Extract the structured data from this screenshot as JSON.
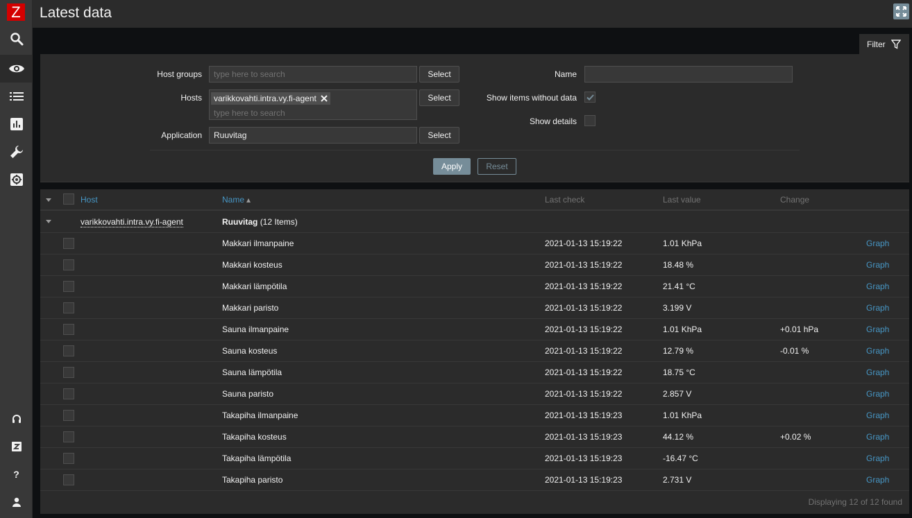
{
  "app": {
    "logo_letter": "Z"
  },
  "header": {
    "title": "Latest data"
  },
  "sidebar": {
    "items": [
      {
        "name": "search",
        "icon": "search-icon"
      },
      {
        "name": "monitoring",
        "icon": "eye-icon",
        "active": true
      },
      {
        "name": "inventory",
        "icon": "list-icon"
      },
      {
        "name": "reports",
        "icon": "bar-chart-icon"
      },
      {
        "name": "configuration",
        "icon": "wrench-icon"
      },
      {
        "name": "administration",
        "icon": "gear-icon"
      }
    ],
    "bottom": [
      {
        "name": "support",
        "icon": "headset-icon"
      },
      {
        "name": "share",
        "icon": "zabbix-share-icon"
      },
      {
        "name": "help",
        "icon": "help-icon",
        "text": "?"
      },
      {
        "name": "user-settings",
        "icon": "user-icon"
      }
    ]
  },
  "filter": {
    "tab_label": "Filter",
    "host_groups_label": "Host groups",
    "host_groups_placeholder": "type here to search",
    "hosts_label": "Hosts",
    "hosts_selected": "varikkovahti.intra.vy.fi-agent",
    "hosts_placeholder": "type here to search",
    "application_label": "Application",
    "application_value": "Ruuvitag",
    "select_label": "Select",
    "name_label": "Name",
    "name_value": "",
    "show_items_without_data_label": "Show items without data",
    "show_items_without_data": true,
    "show_details_label": "Show details",
    "show_details": false,
    "apply_label": "Apply",
    "reset_label": "Reset"
  },
  "table": {
    "columns": {
      "host": "Host",
      "name": "Name",
      "last_check": "Last check",
      "last_value": "Last value",
      "change": "Change"
    },
    "group": {
      "host": "varikkovahti.intra.vy.fi-agent",
      "app": "Ruuvitag",
      "count": "(12 Items)"
    },
    "graph_label": "Graph",
    "rows": [
      {
        "name": "Makkari ilmanpaine",
        "last_check": "2021-01-13 15:19:22",
        "last_value": "1.01 KhPa",
        "change": ""
      },
      {
        "name": "Makkari kosteus",
        "last_check": "2021-01-13 15:19:22",
        "last_value": "18.48 %",
        "change": ""
      },
      {
        "name": "Makkari lämpötila",
        "last_check": "2021-01-13 15:19:22",
        "last_value": "21.41 °C",
        "change": ""
      },
      {
        "name": "Makkari paristo",
        "last_check": "2021-01-13 15:19:22",
        "last_value": "3.199 V",
        "change": ""
      },
      {
        "name": "Sauna ilmanpaine",
        "last_check": "2021-01-13 15:19:22",
        "last_value": "1.01 KhPa",
        "change": "+0.01 hPa"
      },
      {
        "name": "Sauna kosteus",
        "last_check": "2021-01-13 15:19:22",
        "last_value": "12.79 %",
        "change": "-0.01 %"
      },
      {
        "name": "Sauna lämpötila",
        "last_check": "2021-01-13 15:19:22",
        "last_value": "18.75 °C",
        "change": ""
      },
      {
        "name": "Sauna paristo",
        "last_check": "2021-01-13 15:19:22",
        "last_value": "2.857 V",
        "change": ""
      },
      {
        "name": "Takapiha ilmanpaine",
        "last_check": "2021-01-13 15:19:23",
        "last_value": "1.01 KhPa",
        "change": ""
      },
      {
        "name": "Takapiha kosteus",
        "last_check": "2021-01-13 15:19:23",
        "last_value": "44.12 %",
        "change": "+0.02 %"
      },
      {
        "name": "Takapiha lämpötila",
        "last_check": "2021-01-13 15:19:23",
        "last_value": "-16.47 °C",
        "change": ""
      },
      {
        "name": "Takapiha paristo",
        "last_check": "2021-01-13 15:19:23",
        "last_value": "2.731 V",
        "change": ""
      }
    ],
    "footer": "Displaying 12 of 12 found"
  }
}
